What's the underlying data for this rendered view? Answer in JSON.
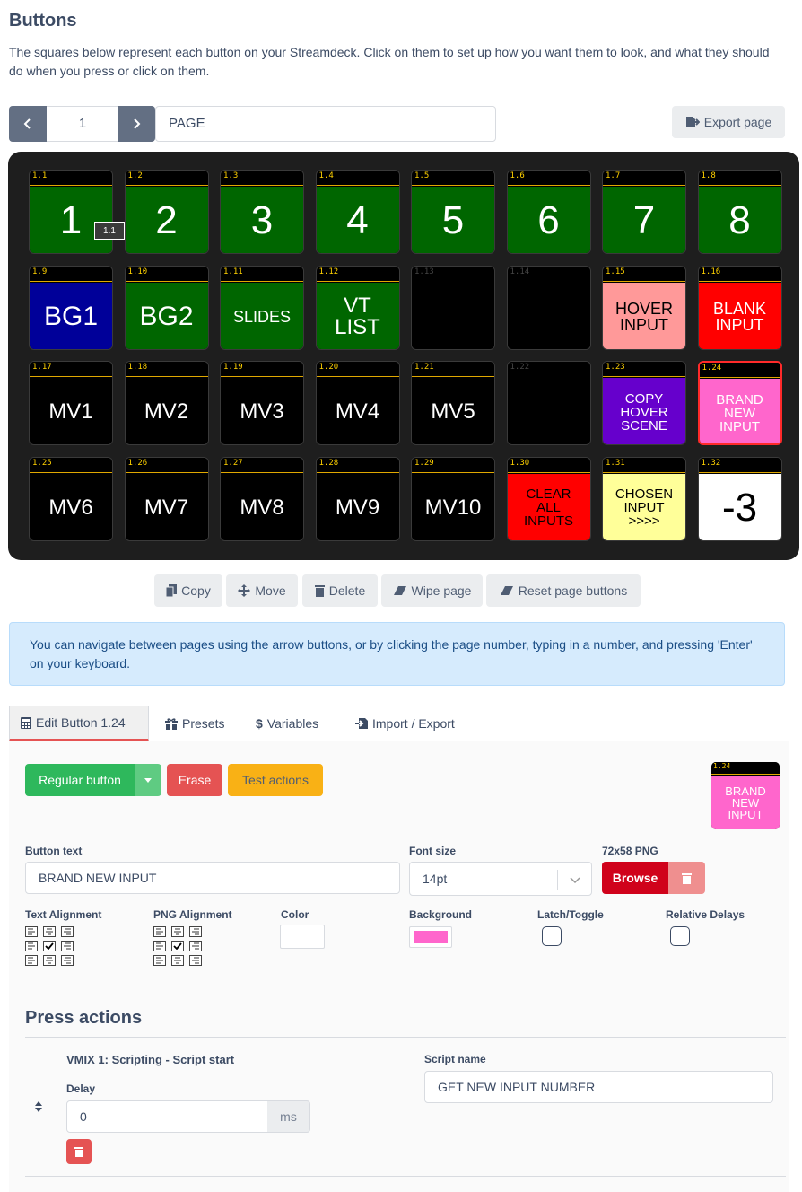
{
  "header": {
    "title": "Buttons",
    "description": "The squares below represent each button on your Streamdeck. Click on them to set up how you want them to look, and what they should do when you press or click on them."
  },
  "page_nav": {
    "page_number": "1",
    "page_name": "PAGE",
    "export_label": "Export page"
  },
  "deck": {
    "buttons": [
      {
        "id": "1.1",
        "text": "1",
        "bg": "#006600",
        "color": "#ffffff",
        "size": 44
      },
      {
        "id": "1.2",
        "text": "2",
        "bg": "#006600",
        "color": "#ffffff",
        "size": 44
      },
      {
        "id": "1.3",
        "text": "3",
        "bg": "#006600",
        "color": "#ffffff",
        "size": 44
      },
      {
        "id": "1.4",
        "text": "4",
        "bg": "#006600",
        "color": "#ffffff",
        "size": 44
      },
      {
        "id": "1.5",
        "text": "5",
        "bg": "#006600",
        "color": "#ffffff",
        "size": 44
      },
      {
        "id": "1.6",
        "text": "6",
        "bg": "#006600",
        "color": "#ffffff",
        "size": 44
      },
      {
        "id": "1.7",
        "text": "7",
        "bg": "#006600",
        "color": "#ffffff",
        "size": 44
      },
      {
        "id": "1.8",
        "text": "8",
        "bg": "#006600",
        "color": "#ffffff",
        "size": 44
      },
      {
        "id": "1.9",
        "text": "BG1",
        "bg": "#000099",
        "color": "#ffffff",
        "size": 30
      },
      {
        "id": "1.10",
        "text": "BG2",
        "bg": "#006600",
        "color": "#ffffff",
        "size": 30
      },
      {
        "id": "1.11",
        "text": "SLIDES",
        "bg": "#006600",
        "color": "#ffffff",
        "size": 18
      },
      {
        "id": "1.12",
        "text": "VT\nLIST",
        "bg": "#006600",
        "color": "#ffffff",
        "size": 24
      },
      {
        "id": "1.13",
        "text": "",
        "bg": "#000000",
        "color": "#ffffff",
        "size": 14,
        "empty": true
      },
      {
        "id": "1.14",
        "text": "",
        "bg": "#000000",
        "color": "#ffffff",
        "size": 14,
        "empty": true
      },
      {
        "id": "1.15",
        "text": "HOVER\nINPUT",
        "bg": "#ff9999",
        "color": "#000000",
        "size": 18
      },
      {
        "id": "1.16",
        "text": "BLANK\nINPUT",
        "bg": "#ff0000",
        "color": "#ffffff",
        "size": 18
      },
      {
        "id": "1.17",
        "text": "MV1",
        "bg": "#000000",
        "color": "#ffffff",
        "size": 24
      },
      {
        "id": "1.18",
        "text": "MV2",
        "bg": "#000000",
        "color": "#ffffff",
        "size": 24
      },
      {
        "id": "1.19",
        "text": "MV3",
        "bg": "#000000",
        "color": "#ffffff",
        "size": 24
      },
      {
        "id": "1.20",
        "text": "MV4",
        "bg": "#000000",
        "color": "#ffffff",
        "size": 24
      },
      {
        "id": "1.21",
        "text": "MV5",
        "bg": "#000000",
        "color": "#ffffff",
        "size": 24
      },
      {
        "id": "1.22",
        "text": "",
        "bg": "#000000",
        "color": "#ffffff",
        "size": 14,
        "empty": true
      },
      {
        "id": "1.23",
        "text": "COPY\nHOVER\nSCENE",
        "bg": "#6600cc",
        "color": "#ffffff",
        "size": 15
      },
      {
        "id": "1.24",
        "text": "BRAND\nNEW\nINPUT",
        "bg": "#ff66cc",
        "color": "#ffffff",
        "size": 15,
        "selected": true
      },
      {
        "id": "1.25",
        "text": "MV6",
        "bg": "#000000",
        "color": "#ffffff",
        "size": 24
      },
      {
        "id": "1.26",
        "text": "MV7",
        "bg": "#000000",
        "color": "#ffffff",
        "size": 24
      },
      {
        "id": "1.27",
        "text": "MV8",
        "bg": "#000000",
        "color": "#ffffff",
        "size": 24
      },
      {
        "id": "1.28",
        "text": "MV9",
        "bg": "#000000",
        "color": "#ffffff",
        "size": 24
      },
      {
        "id": "1.29",
        "text": "MV10",
        "bg": "#000000",
        "color": "#ffffff",
        "size": 24
      },
      {
        "id": "1.30",
        "text": "CLEAR\nALL\nINPUTS",
        "bg": "#ff0000",
        "color": "#000000",
        "size": 15
      },
      {
        "id": "1.31",
        "text": "CHOSEN\nINPUT\n>>>>",
        "bg": "#ffff99",
        "color": "#000000",
        "size": 15
      },
      {
        "id": "1.32",
        "text": "-3",
        "bg": "#ffffff",
        "color": "#000000",
        "size": 44
      }
    ],
    "hover_tooltip": "1.1"
  },
  "deck_actions": {
    "copy": "Copy",
    "move": "Move",
    "delete": "Delete",
    "wipe": "Wipe page",
    "reset": "Reset page buttons"
  },
  "info_text": "You can navigate between pages using the arrow buttons, or by clicking the page number, typing in a number, and pressing 'Enter' on your keyboard.",
  "tabs": {
    "edit": "Edit Button 1.24",
    "presets": "Presets",
    "variables": "Variables",
    "import_export": "Import / Export"
  },
  "editor": {
    "button_type": "Regular button",
    "erase": "Erase",
    "test_actions": "Test actions",
    "preview": {
      "id": "1.24",
      "text": "BRAND\nNEW\nINPUT"
    },
    "button_text_label": "Button text",
    "button_text_value": "BRAND NEW INPUT",
    "font_size_label": "Font size",
    "font_size_value": "14pt",
    "png_label": "72x58 PNG",
    "browse": "Browse",
    "text_alignment_label": "Text Alignment",
    "png_alignment_label": "PNG Alignment",
    "color_label": "Color",
    "background_label": "Background",
    "latch_label": "Latch/Toggle",
    "relative_delays_label": "Relative Delays",
    "text_color": "#ffffff",
    "background_color": "#ff66cc"
  },
  "press_actions": {
    "title": "Press actions",
    "action_name": "VMIX 1: Scripting - Script start",
    "delay_label": "Delay",
    "delay_value": "0",
    "delay_unit": "ms",
    "script_name_label": "Script name",
    "script_name_value": "GET NEW INPUT NUMBER"
  }
}
